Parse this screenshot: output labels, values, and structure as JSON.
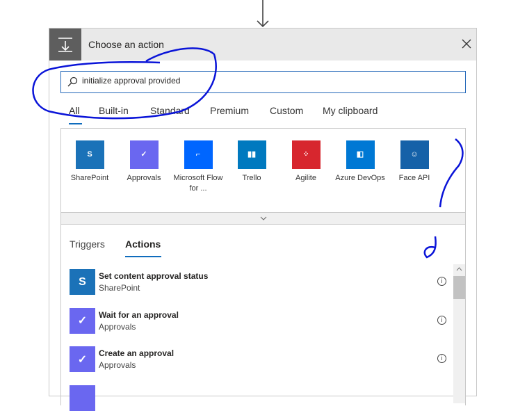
{
  "header": {
    "title": "Choose an action",
    "icon": "action-icon",
    "close": "close-icon"
  },
  "search": {
    "value": "initialize approval provided",
    "icon": "search-icon"
  },
  "tabs": [
    {
      "label": "All",
      "active": true
    },
    {
      "label": "Built-in"
    },
    {
      "label": "Standard"
    },
    {
      "label": "Premium"
    },
    {
      "label": "Custom"
    },
    {
      "label": "My clipboard"
    }
  ],
  "connectors": [
    {
      "label": "SharePoint",
      "color": "#1b72b8",
      "glyph": "S"
    },
    {
      "label": "Approvals",
      "color": "#6a67f0",
      "glyph": "✓"
    },
    {
      "label": "Microsoft Flow for ...",
      "color": "#0066ff",
      "glyph": "⌐"
    },
    {
      "label": "Trello",
      "color": "#0079bf",
      "glyph": "▮▮"
    },
    {
      "label": "Agilite",
      "color": "#d7262e",
      "glyph": "⁘"
    },
    {
      "label": "Azure DevOps",
      "color": "#0078d4",
      "glyph": "◧"
    },
    {
      "label": "Face API",
      "color": "#1561a8",
      "glyph": "☺"
    }
  ],
  "subtabs": [
    {
      "label": "Triggers"
    },
    {
      "label": "Actions",
      "active": true
    }
  ],
  "actions": [
    {
      "title": "Set content approval status",
      "subtitle": "SharePoint",
      "color": "#1b72b8",
      "glyph": "S"
    },
    {
      "title": "Wait for an approval",
      "subtitle": "Approvals",
      "color": "#6a67f0",
      "glyph": "✓"
    },
    {
      "title": "Create an approval",
      "subtitle": "Approvals",
      "color": "#6a67f0",
      "glyph": "✓"
    },
    {
      "title": "",
      "subtitle": "",
      "color": "#6a67f0",
      "glyph": ""
    }
  ],
  "colors": {
    "accent": "#0f6cbd",
    "annotation": "#0a14d8"
  }
}
